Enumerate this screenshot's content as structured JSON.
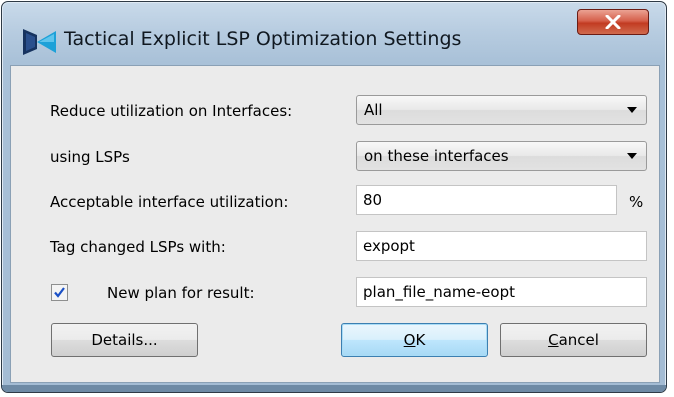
{
  "window": {
    "title": "Tactical Explicit LSP Optimization Settings",
    "close_glyph": "X"
  },
  "form": {
    "reduce_label": "Reduce utilization on Interfaces:",
    "reduce_value": "All",
    "using_label": "using LSPs",
    "using_value": "on these interfaces",
    "util_label": "Acceptable interface utilization:",
    "util_value": "80",
    "util_unit": "%",
    "tag_label": "Tag changed LSPs with:",
    "tag_value": "expopt",
    "newplan_label": "New plan for result:",
    "newplan_checked": true,
    "newplan_value": "plan_file_name-eopt"
  },
  "buttons": {
    "details": "Details...",
    "ok_mnemonic": "O",
    "ok_rest": "K",
    "cancel_mnemonic": "C",
    "cancel_rest": "ancel"
  },
  "colors": {
    "frame": "#a9c1d8",
    "close": "#c23b22",
    "default_button": "#bee6fd",
    "check": "#1a50c6"
  }
}
